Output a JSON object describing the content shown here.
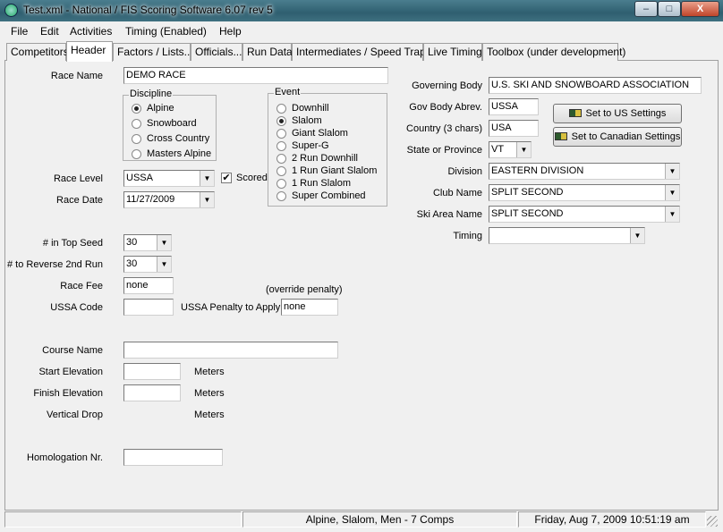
{
  "window": {
    "title": "Test.xml - National / FIS Scoring Software 6.07 rev 5",
    "min": "‒",
    "max": "□",
    "close": "X"
  },
  "menu": {
    "file": "File",
    "edit": "Edit",
    "activities": "Activities",
    "timing": "Timing (Enabled)",
    "help": "Help"
  },
  "tabs": [
    "Competitors",
    "Header",
    "Factors / Lists...",
    "Officials...",
    "Run Data",
    "Intermediates / Speed Traps",
    "Live Timing",
    "Toolbox (under development)"
  ],
  "left": {
    "race_name_label": "Race Name",
    "race_name_value": "DEMO RACE",
    "discipline_title": "Discipline",
    "disciplines": [
      "Alpine",
      "Snowboard",
      "Cross Country",
      "Masters Alpine"
    ],
    "event_title": "Event",
    "events": [
      "Downhill",
      "Slalom",
      "Giant Slalom",
      "Super-G",
      "2 Run Downhill",
      "1 Run Giant Slalom",
      "1 Run Slalom",
      "Super Combined"
    ],
    "race_level_label": "Race Level",
    "race_level_value": "USSA",
    "scored_label": "Scored",
    "scored_check": "✔",
    "race_date_label": "Race Date",
    "race_date_value": "11/27/2009",
    "top_seed_label": "# in Top Seed",
    "top_seed_value": "30",
    "reverse_label": "# to Reverse 2nd Run",
    "reverse_value": "30",
    "race_fee_label": "Race Fee",
    "race_fee_value": "none",
    "override_label": "(override penalty)",
    "ussa_code_label": "USSA Code",
    "ussa_code_value": "",
    "penalty_label": "USSA Penalty to Apply",
    "penalty_value": "none",
    "course_name_label": "Course Name",
    "course_name_value": "",
    "start_elev_label": "Start Elevation",
    "start_elev_value": "",
    "finish_elev_label": "Finish Elevation",
    "finish_elev_value": "",
    "vertical_drop_label": "Vertical Drop",
    "meters": "Meters",
    "homologation_label": "Homologation Nr.",
    "homologation_value": ""
  },
  "right": {
    "gov_body_label": "Governing Body",
    "gov_body_value": "U.S. SKI AND SNOWBOARD ASSOCIATION",
    "gov_abbrev_label": "Gov Body Abrev.",
    "gov_abbrev_value": "USSA",
    "country_label": "Country (3 chars)",
    "country_value": "USA",
    "state_label": "State or Province",
    "state_value": "VT",
    "us_settings_button": "Set to US Settings",
    "ca_settings_button": "Set to Canadian Settings",
    "division_label": "Division",
    "division_value": "EASTERN DIVISION",
    "club_label": "Club Name",
    "club_value": "SPLIT SECOND",
    "ski_area_label": "Ski Area Name",
    "ski_area_value": "SPLIT SECOND",
    "timing_label": "Timing",
    "timing_value": ""
  },
  "status": {
    "left": "",
    "middle": "Alpine, Slalom, Men - 7 Comps",
    "right": "Friday, Aug 7, 2009  10:51:19 am"
  },
  "selected": {
    "discipline": "Alpine",
    "event": "Slalom"
  }
}
